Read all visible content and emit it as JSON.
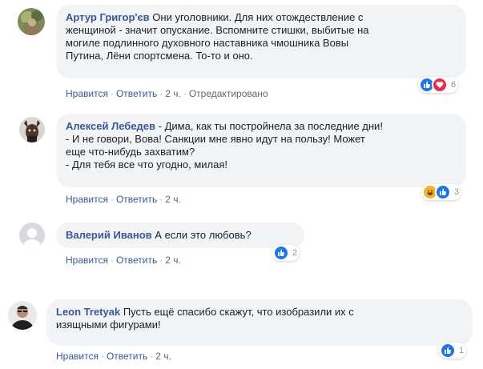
{
  "actions": {
    "like": "Нравится",
    "reply": "Ответить",
    "separator": "·"
  },
  "comments": [
    {
      "author": "Артур Григор'єв",
      "text": "Они уголовники. Для них отождествление с\nженщиной - значит опускание. Вспомните стишки, выбитые на\nмогиле подлинного духовного наставника чмошника Вовы\nПутина, Лёни спортсмена. То-то и оно.",
      "time": "2 ч.",
      "edited": "Отредактировано",
      "reactions": [
        "like",
        "love"
      ],
      "reaction_count": "6"
    },
    {
      "author": "Алексей Лебедев",
      "text": "- Дима, как ты постройнела за последние дни!\n- И не говори, Вова! Санкции мне явно идут на пользу! Может\nеще что-нибудь захватим?\n- Для тебя все что угодно, милая!",
      "time": "2 ч.",
      "reactions": [
        "haha",
        "like"
      ],
      "reaction_count": "3"
    },
    {
      "author": "Валерий Иванов",
      "text": "А если это любовь?",
      "time": "2 ч.",
      "reactions": [
        "like"
      ],
      "reaction_count": "2"
    },
    {
      "author": "Leon Tretyak",
      "text": "Пусть ещё спасибо скажут, что изобразили их с\nизящными фигурами!",
      "time": "2 ч.",
      "reactions": [
        "like"
      ],
      "reaction_count": "1"
    }
  ],
  "colors": {
    "link": "#385898",
    "bubble": "#f2f3f5",
    "like": "#1877f2",
    "love": "#f0284a",
    "haha": "#f7b125"
  }
}
